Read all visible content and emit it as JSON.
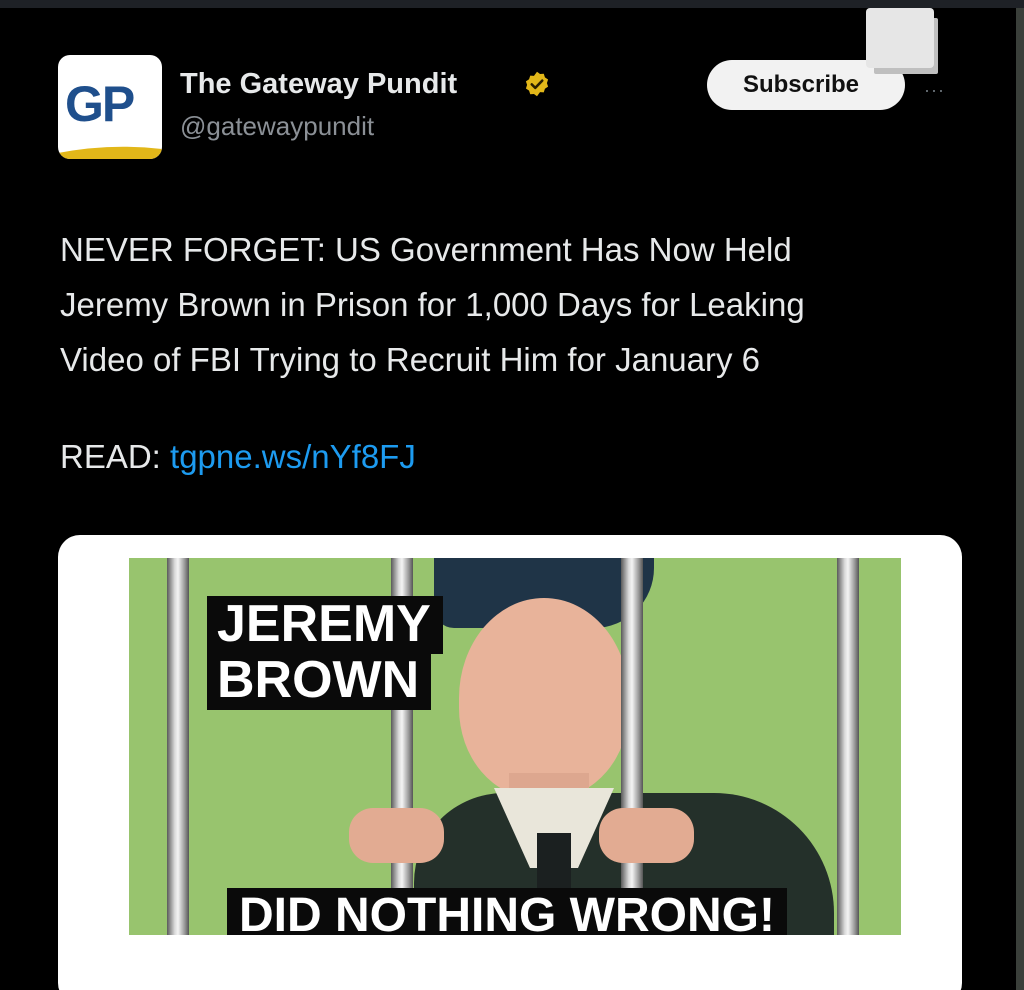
{
  "post": {
    "author": {
      "name": "The Gateway Pundit",
      "handle": "@gatewaypundit",
      "avatar_text": "GP",
      "verified_badge": "gold-check-icon"
    },
    "subscribe_label": "Subscribe",
    "more_icon": "more-dots-icon",
    "text_lines": [
      "NEVER FORGET: US Government Has Now Held",
      "Jeremy Brown in Prison for 1,000 Days for Leaking",
      "Video of FBI Trying to Recruit Him for January 6"
    ],
    "read_label": "READ:",
    "link_text": "tgpne.ws/nYf8FJ",
    "media": {
      "title_line1": "JEREMY",
      "title_line2": "BROWN",
      "banner": "DID NOTHING WRONG!"
    }
  },
  "colors": {
    "background": "#000000",
    "link": "#1d9bf0",
    "verified": "#e2b719",
    "photo_bg": "#98c46e",
    "avatar_text": "#1f4f8c"
  }
}
